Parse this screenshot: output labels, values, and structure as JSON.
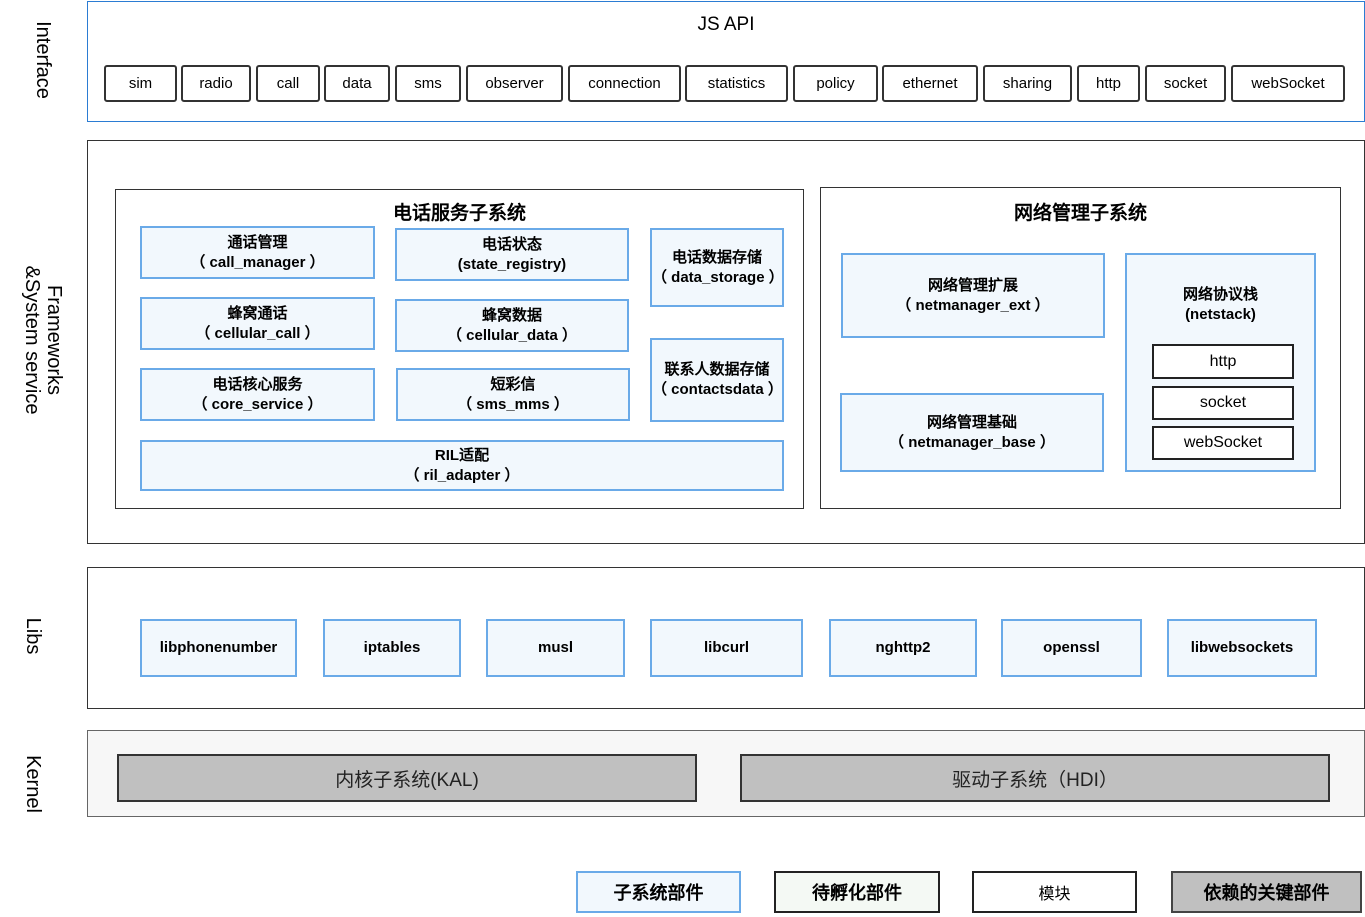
{
  "layers": {
    "interface": "Interface",
    "frameworks": "Frameworks\n&System service",
    "libs": "Libs",
    "kernel": "Kernel"
  },
  "js_api": {
    "title": "JS API",
    "items": [
      "sim",
      "radio",
      "call",
      "data",
      "sms",
      "observer",
      "connection",
      "statistics",
      "policy",
      "ethernet",
      "sharing",
      "http",
      "socket",
      "webSocket"
    ]
  },
  "telephony": {
    "title": "电话服务子系统",
    "modules": [
      {
        "name": "通话管理",
        "id": "（ call_manager ）"
      },
      {
        "name": "电话状态",
        "id": "(state_registry)"
      },
      {
        "name": "电话数据存储",
        "id": "（ data_storage ）"
      },
      {
        "name": "蜂窝通话",
        "id": "（ cellular_call ）"
      },
      {
        "name": "蜂窝数据",
        "id": "（ cellular_data ）"
      },
      {
        "name": "联系人数据存储",
        "id": "（ contactsdata ）"
      },
      {
        "name": "电话核心服务",
        "id": "（ core_service ）"
      },
      {
        "name": "短彩信",
        "id": "（ sms_mms ）"
      },
      {
        "name": "RIL适配",
        "id": "（ ril_adapter ）"
      }
    ]
  },
  "network": {
    "title": "网络管理子系统",
    "modules": [
      {
        "name": "网络管理扩展",
        "id": "（ netmanager_ext ）"
      },
      {
        "name": "网络管理基础",
        "id": "（ netmanager_base ）"
      },
      {
        "name": "网络协议栈",
        "id": "(netstack)"
      }
    ],
    "netstack_items": [
      "http",
      "socket",
      "webSocket"
    ]
  },
  "libs": [
    "libphonenumber",
    "iptables",
    "musl",
    "libcurl",
    "nghttp2",
    "openssl",
    "libwebsockets"
  ],
  "kernel": [
    "内核子系统(KAL)",
    "驱动子系统（HDI）"
  ],
  "legend": [
    {
      "label": "子系统部件",
      "color": "#f2f8fd",
      "border": "#6aaae8"
    },
    {
      "label": "待孵化部件",
      "color": "#f4f9f4",
      "border": "#222222"
    },
    {
      "label": "模块",
      "color": "#ffffff",
      "border": "#222222"
    },
    {
      "label": "依赖的关键部件",
      "color": "#c0c0c0",
      "border": "#444444"
    }
  ],
  "colors": {
    "api_border": "#2b7cd3",
    "module_fill": "#f2f8fd",
    "module_border": "#6aaae8",
    "kernel_fill": "#c0c0c0",
    "kernel_bg": "#f7f7f7"
  }
}
